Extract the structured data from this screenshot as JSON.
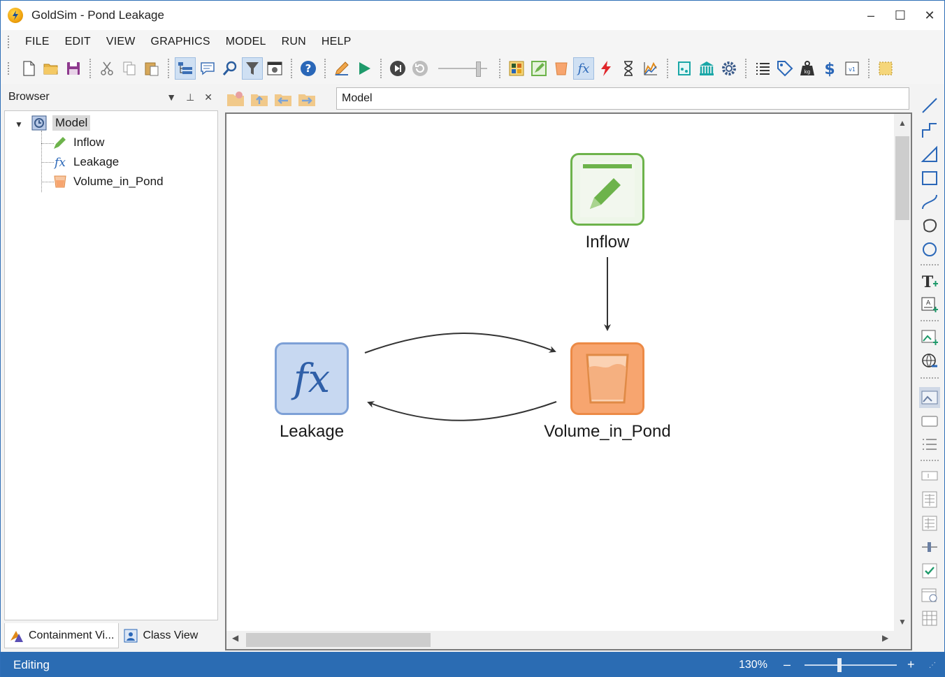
{
  "window": {
    "app_name": "GoldSim",
    "title": " - Pond Leakage",
    "minimize": "–",
    "maximize": "☐",
    "close": "✕"
  },
  "menu": [
    "FILE",
    "EDIT",
    "VIEW",
    "GRAPHICS",
    "MODEL",
    "RUN",
    "HELP"
  ],
  "browser": {
    "title": "Browser",
    "dropdown": "▼",
    "pin": "📌",
    "close": "✕",
    "tree": {
      "root": "Model",
      "children": [
        "Inflow",
        "Leakage",
        "Volume_in_Pond"
      ]
    },
    "tabs": [
      "Containment Vi...",
      "Class View"
    ]
  },
  "navigation": {
    "path": "Model"
  },
  "canvas": {
    "nodes": {
      "inflow": "Inflow",
      "leakage": "Leakage",
      "volume": "Volume_in_Pond"
    },
    "expr_symbol": "fx"
  },
  "status": {
    "mode": "Editing",
    "zoom": "130%",
    "zoom_out": "–",
    "zoom_in": "+",
    "zoom_fraction": 0.38
  },
  "colors": {
    "accent": "#2b6cb3",
    "data_element": "#6db34b",
    "expression_element": "#7da0d6",
    "pool_element": "#ec8a46"
  }
}
